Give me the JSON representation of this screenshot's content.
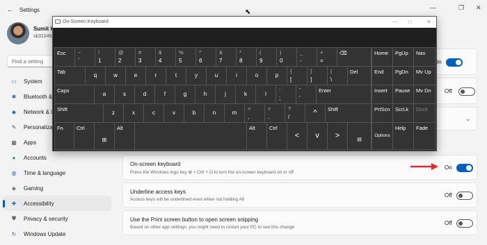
{
  "window": {
    "title": "Settings",
    "controls": [
      "—",
      "❐",
      "✕"
    ]
  },
  "user": {
    "name": "Sumit k",
    "email": "sk310464"
  },
  "search": {
    "placeholder": "Find a setting"
  },
  "nav": {
    "items": [
      {
        "label": "System",
        "icon": "monitor-icon",
        "active": false
      },
      {
        "label": "Bluetooth &",
        "icon": "bluetooth-icon",
        "active": false
      },
      {
        "label": "Network & i",
        "icon": "network-icon",
        "active": false
      },
      {
        "label": "Personalizati",
        "icon": "brush-icon",
        "active": false
      },
      {
        "label": "Apps",
        "icon": "apps-icon",
        "active": false
      },
      {
        "label": "Accounts",
        "icon": "account-icon",
        "active": false
      },
      {
        "label": "Time & language",
        "icon": "globe-icon",
        "active": false
      },
      {
        "label": "Gaming",
        "icon": "controller-icon",
        "active": false
      },
      {
        "label": "Accessibility",
        "icon": "accessibility-icon",
        "active": true
      },
      {
        "label": "Privacy & security",
        "icon": "shield-icon",
        "active": false
      },
      {
        "label": "Windows Update",
        "icon": "update-icon",
        "active": false
      }
    ]
  },
  "partial_cards": [
    {
      "state_label": "On",
      "toggle": true
    },
    {
      "state_label": "Off",
      "toggle": false
    },
    {
      "state_label": "",
      "toggle": null
    }
  ],
  "cards": [
    {
      "title": "On-screen keyboard",
      "description": "Press the Windows logo key ⊞ + Ctrl + O to turn the on-screen keyboard on or off",
      "state_label": "On",
      "toggle": true
    },
    {
      "title": "Underline access keys",
      "description": "Access keys will be underlined even when not holding Alt",
      "state_label": "Off",
      "toggle": false
    },
    {
      "title": "Use the Print screen button to open screen snipping",
      "description": "Based on other app settings, you might need to restart your PC to see this change",
      "state_label": "Off",
      "toggle": false
    }
  ],
  "osk": {
    "title": "On-Screen Keyboard",
    "controls": [
      "—",
      "□",
      "✕"
    ],
    "keys": {
      "esc": "Esc",
      "grave": [
        "~",
        "`"
      ],
      "n1": [
        "!",
        "1"
      ],
      "n2": [
        "@",
        "2"
      ],
      "n3": [
        "#",
        "3"
      ],
      "n4": [
        "$",
        "4"
      ],
      "n5": [
        "%",
        "5"
      ],
      "n6": [
        "^",
        "6"
      ],
      "n7": [
        "&",
        "7"
      ],
      "n8": [
        "*",
        "8"
      ],
      "n9": [
        "(",
        "9"
      ],
      "n0": [
        ")",
        "0"
      ],
      "minus": [
        "_",
        "-"
      ],
      "equal": [
        "+",
        "="
      ],
      "bksp": "⌫",
      "tab": "Tab",
      "q": "q",
      "w": "w",
      "e": "e",
      "r": "r",
      "t": "t",
      "y": "y",
      "u": "u",
      "i": "i",
      "o": "o",
      "p": "p",
      "lbr": [
        "{",
        "["
      ],
      "rbr": [
        "}",
        "]"
      ],
      "bsl": [
        "|",
        "\\"
      ],
      "del": "Del",
      "caps": "Caps",
      "a": "a",
      "s": "s",
      "d": "d",
      "f": "f",
      "g": "g",
      "h": "h",
      "j": "j",
      "k": "k",
      "l": "l",
      "semi": [
        ":",
        ";"
      ],
      "quote": [
        "\"",
        "'"
      ],
      "enter": "Enter",
      "lshift": "Shift",
      "z": "z",
      "x": "x",
      "c": "c",
      "v": "v",
      "b": "b",
      "n": "n",
      "m": "m",
      "comma": [
        "<",
        ","
      ],
      "period": [
        ">",
        "."
      ],
      "slash": [
        "?",
        "/"
      ],
      "up": "^",
      "rshift": "Shift",
      "fn": "Fn",
      "lctrl": "Ctrl",
      "win": "⊞",
      "lalt": "Alt",
      "ralt": "Alt",
      "rctrl": "Ctrl",
      "left": "<",
      "down": "v",
      "right": ">",
      "menu": "▤",
      "home": "Home",
      "pgup": "PgUp",
      "nav": "Nav",
      "end": "End",
      "pgdn": "PgDn",
      "mvup": "Mv Up",
      "insert": "Insert",
      "pause": "Pause",
      "mvdn": "Mv Dn",
      "prtscn": "PrtScn",
      "scrlk": "ScrLk",
      "dock": "Dock",
      "options": "Options",
      "help": "Help",
      "fade": "Fade"
    }
  }
}
